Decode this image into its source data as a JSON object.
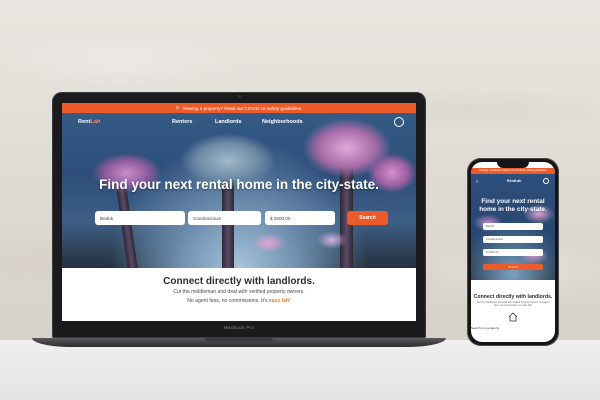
{
  "laptop": {
    "brand_text": "MacBook Pro",
    "banner_text": "Viewing a property? Read our COVID-19 safety guidelines.",
    "logo": {
      "main": "Rent",
      "accent": "Lah"
    },
    "nav": [
      "Renters",
      "Landlords",
      "Neighborhoods"
    ],
    "headline": "Find your next rental home in the city-state.",
    "search": {
      "location": "Bedok",
      "property_type": "Condominium",
      "price": "$ 2600.00",
      "button": "Search"
    },
    "section_title": "Connect directly with landlords.",
    "section_line1": "Cut the middleman and deal with verified property owners.",
    "section_line2": "No agent fees, no commissions. It's ",
    "section_highlight": "easy lah!"
  },
  "phone": {
    "banner_text": "Viewing a property? Read our COVID-19 safety guidelines.",
    "logo": "RentLah",
    "headline": "Find your next rental home in the city-state.",
    "fields": [
      "Bedok",
      "Condominium",
      "$ 2600.00"
    ],
    "button": "Search",
    "section_title": "Connect directly with landlords.",
    "section_text": "Cut the middleman and deal with verified property owners. No agent fees, no commissions. It's easy lah!",
    "icon_label": "Search for a property"
  },
  "colors": {
    "accent": "#ee5b2b",
    "highlight": "#ee7a2b"
  }
}
